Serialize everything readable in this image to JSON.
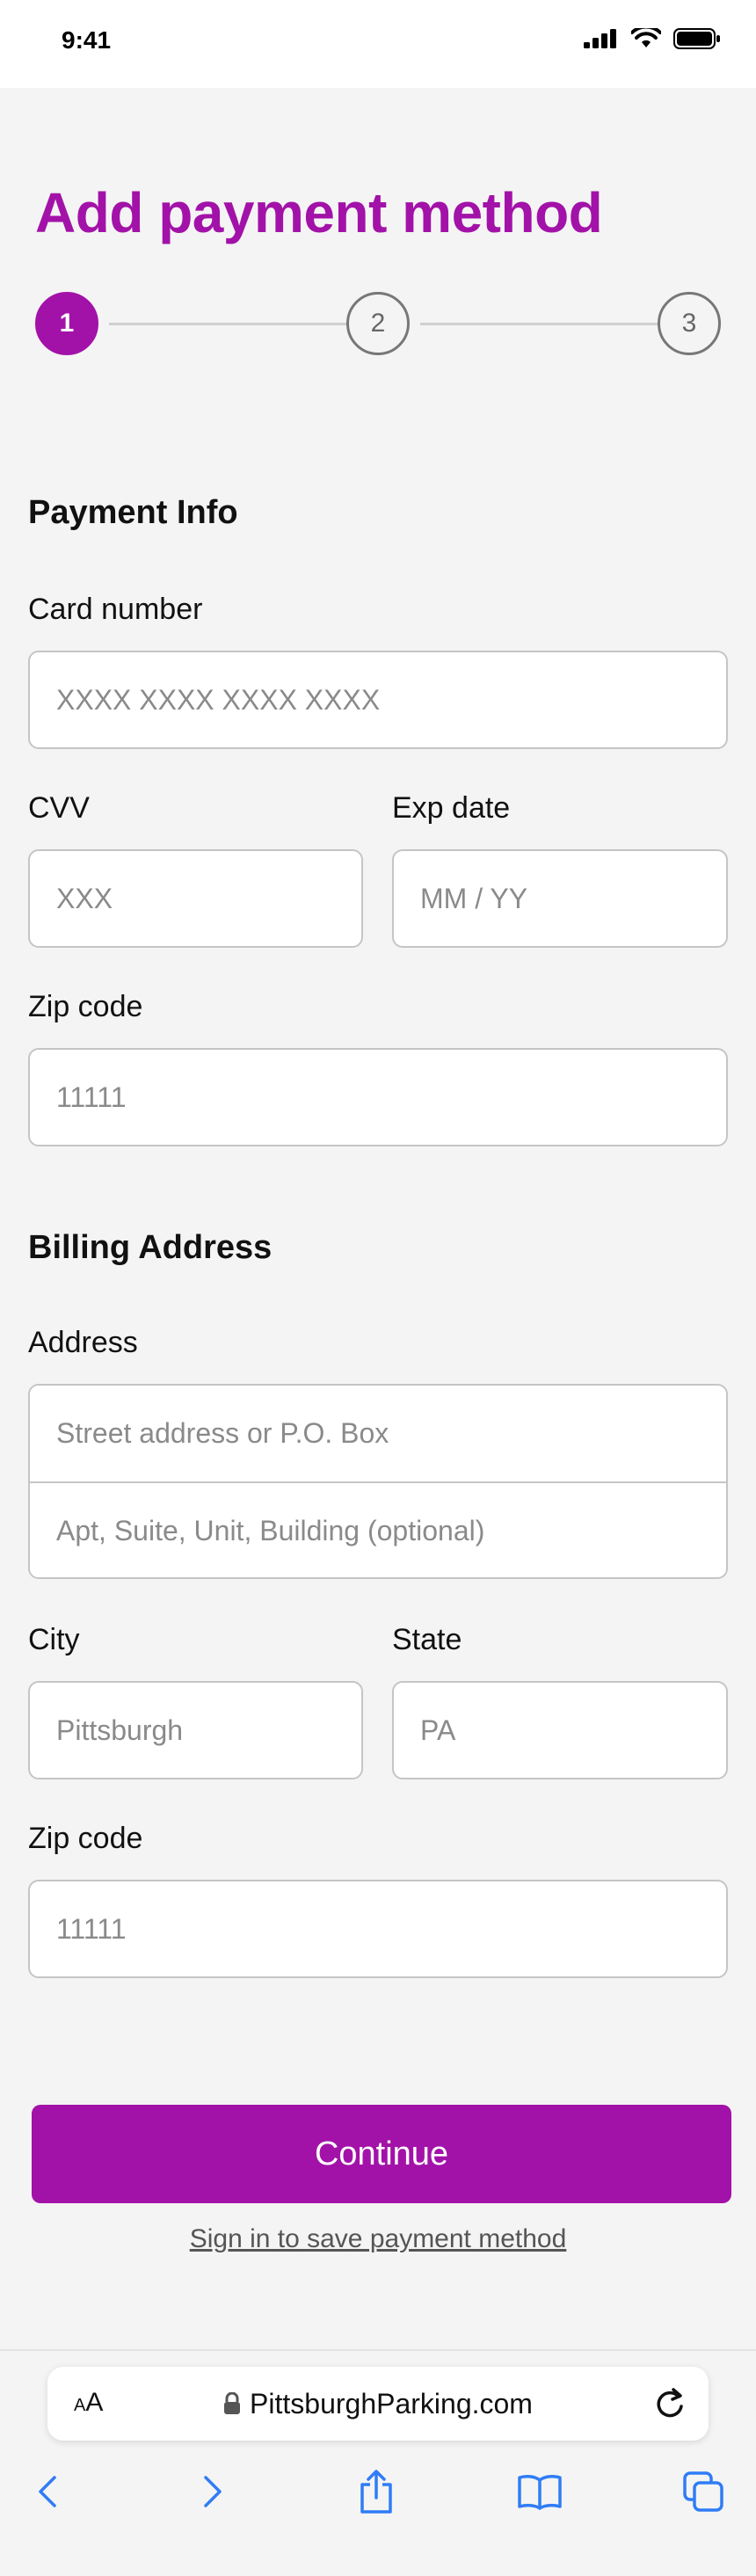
{
  "status_bar": {
    "time": "9:41"
  },
  "page": {
    "title": "Add payment method",
    "steps": [
      "1",
      "2",
      "3"
    ],
    "active_step": 1,
    "accent_color": "#a212a8"
  },
  "payment_info": {
    "section_title": "Payment Info",
    "card_number": {
      "label": "Card number",
      "placeholder": "XXXX XXXX XXXX XXXX"
    },
    "cvv": {
      "label": "CVV",
      "placeholder": "XXX"
    },
    "exp_date": {
      "label": "Exp date",
      "placeholder": "MM / YY"
    },
    "zip": {
      "label": "Zip code",
      "placeholder": "11111"
    }
  },
  "billing_address": {
    "section_title": "Billing Address",
    "address": {
      "label": "Address",
      "line1_placeholder": "Street address or P.O. Box",
      "line2_placeholder": "Apt, Suite, Unit, Building (optional)"
    },
    "city": {
      "label": "City",
      "placeholder": "Pittsburgh"
    },
    "state": {
      "label": "State",
      "placeholder": "PA"
    },
    "zip": {
      "label": "Zip code",
      "placeholder": "11111"
    }
  },
  "actions": {
    "continue_label": "Continue",
    "sign_in_label": "Sign in to save payment method"
  },
  "browser": {
    "text_size_label_small": "A",
    "text_size_label_large": "A",
    "url": "PittsburghParking.com",
    "icon_color": "#2f7cf6",
    "icons": [
      "back-icon",
      "forward-icon",
      "share-icon",
      "bookmarks-icon",
      "tabs-icon"
    ]
  }
}
